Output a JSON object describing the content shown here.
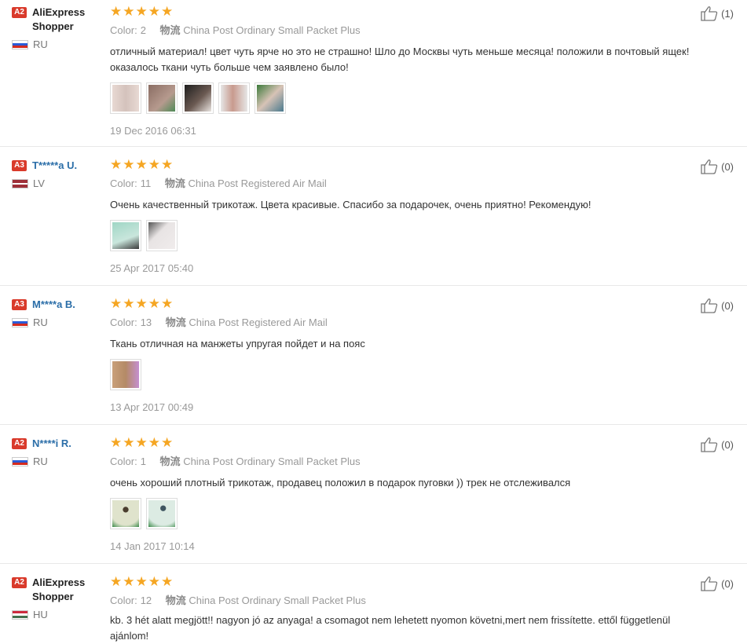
{
  "shipping_prefix": "物流",
  "color_label": "Color:",
  "reviews": [
    {
      "level": "A2",
      "name": "AliExpress Shopper",
      "country": "RU",
      "color": "2",
      "shipping": "China Post Ordinary Small Packet Plus",
      "text": "отличный материал! цвет чуть ярче но это не страшно! Шло до Москвы чуть меньше месяца! положили в почтовый ящек! оказалось ткани чуть больше чем заявлено было!",
      "likes": "(1)",
      "date": "19 Dec 2016 06:31",
      "rating": 5
    },
    {
      "level": "A3",
      "name": "T*****a U.",
      "country": "LV",
      "color": "11",
      "shipping": "China Post Registered Air Mail",
      "text": "Очень качественный трикотаж. Цвета красивые. Спасибо за подарочек, очень приятно! Рекомендую!",
      "likes": "(0)",
      "date": "25 Apr 2017 05:40",
      "rating": 5
    },
    {
      "level": "A3",
      "name": "M****a B.",
      "country": "RU",
      "color": "13",
      "shipping": "China Post Registered Air Mail",
      "text": "Ткань отличная на манжеты упругая пойдет и на пояс",
      "likes": "(0)",
      "date": "13 Apr 2017 00:49",
      "rating": 5
    },
    {
      "level": "A2",
      "name": "N****i R.",
      "country": "RU",
      "color": "1",
      "shipping": "China Post Ordinary Small Packet Plus",
      "text": "очень хороший плотный трикотаж, продавец положил в подарок пуговки )) трек не отслеживался",
      "likes": "(0)",
      "date": "14 Jan 2017 10:14",
      "rating": 5
    },
    {
      "level": "A2",
      "name": "AliExpress Shopper",
      "country": "HU",
      "color": "12",
      "shipping": "China Post Ordinary Small Packet Plus",
      "text": "kb. 3 hét alatt megjött!! nagyon jó az anyaga! a csomagot nem lehetett nyomon követni,mert nem frissítette. ettől függetlenül ajánlom!",
      "likes": "(0)",
      "date": "",
      "rating": 5
    }
  ],
  "colors": {
    "star": "#f5a623",
    "level_badge": "#d93a2b",
    "user_link": "#2b6ea8"
  },
  "icons": {
    "like": "thumbs-up-icon",
    "star": "star-icon"
  }
}
